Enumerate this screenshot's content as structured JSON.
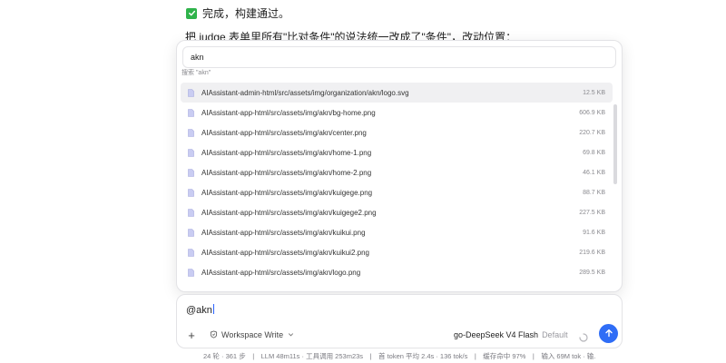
{
  "chat": {
    "done_text": "完成，构建通过。",
    "summary_text": "把 judge 表单里所有\"比对条件\"的说法统一改成了\"条件\"，改动位置："
  },
  "file_picker": {
    "query": "akn",
    "hint": "搜索 \"akn\"",
    "items": [
      {
        "path": "AIAssistant-admin-html/src/assets/img/organization/akn/logo.svg",
        "size": "12.5 KB"
      },
      {
        "path": "AIAssistant-app-html/src/assets/img/akn/bg-home.png",
        "size": "606.9 KB"
      },
      {
        "path": "AIAssistant-app-html/src/assets/img/akn/center.png",
        "size": "220.7 KB"
      },
      {
        "path": "AIAssistant-app-html/src/assets/img/akn/home-1.png",
        "size": "69.8 KB"
      },
      {
        "path": "AIAssistant-app-html/src/assets/img/akn/home-2.png",
        "size": "46.1 KB"
      },
      {
        "path": "AIAssistant-app-html/src/assets/img/akn/kuigege.png",
        "size": "88.7 KB"
      },
      {
        "path": "AIAssistant-app-html/src/assets/img/akn/kuigege2.png",
        "size": "227.5 KB"
      },
      {
        "path": "AIAssistant-app-html/src/assets/img/akn/kuikui.png",
        "size": "91.6 KB"
      },
      {
        "path": "AIAssistant-app-html/src/assets/img/akn/kuikui2.png",
        "size": "219.6 KB"
      },
      {
        "path": "AIAssistant-app-html/src/assets/img/akn/logo.png",
        "size": "289.5 KB"
      }
    ]
  },
  "composer": {
    "input_value": "@akn",
    "add_label": "+",
    "workspace_label": "Workspace Write",
    "model_name": "go-DeepSeek V4 Flash",
    "model_variant": "Default"
  },
  "status_bar": {
    "text": "24 轮 · 361 步　|　LLM 48m11s · 工具调用 253m23s　|　首 token 平均 2.4s · 136 tok/s　|　缓存命中 97%　|　输入 69M tok · 输..."
  },
  "colors": {
    "accent": "#2f6df6",
    "check": "#2fb34b"
  }
}
